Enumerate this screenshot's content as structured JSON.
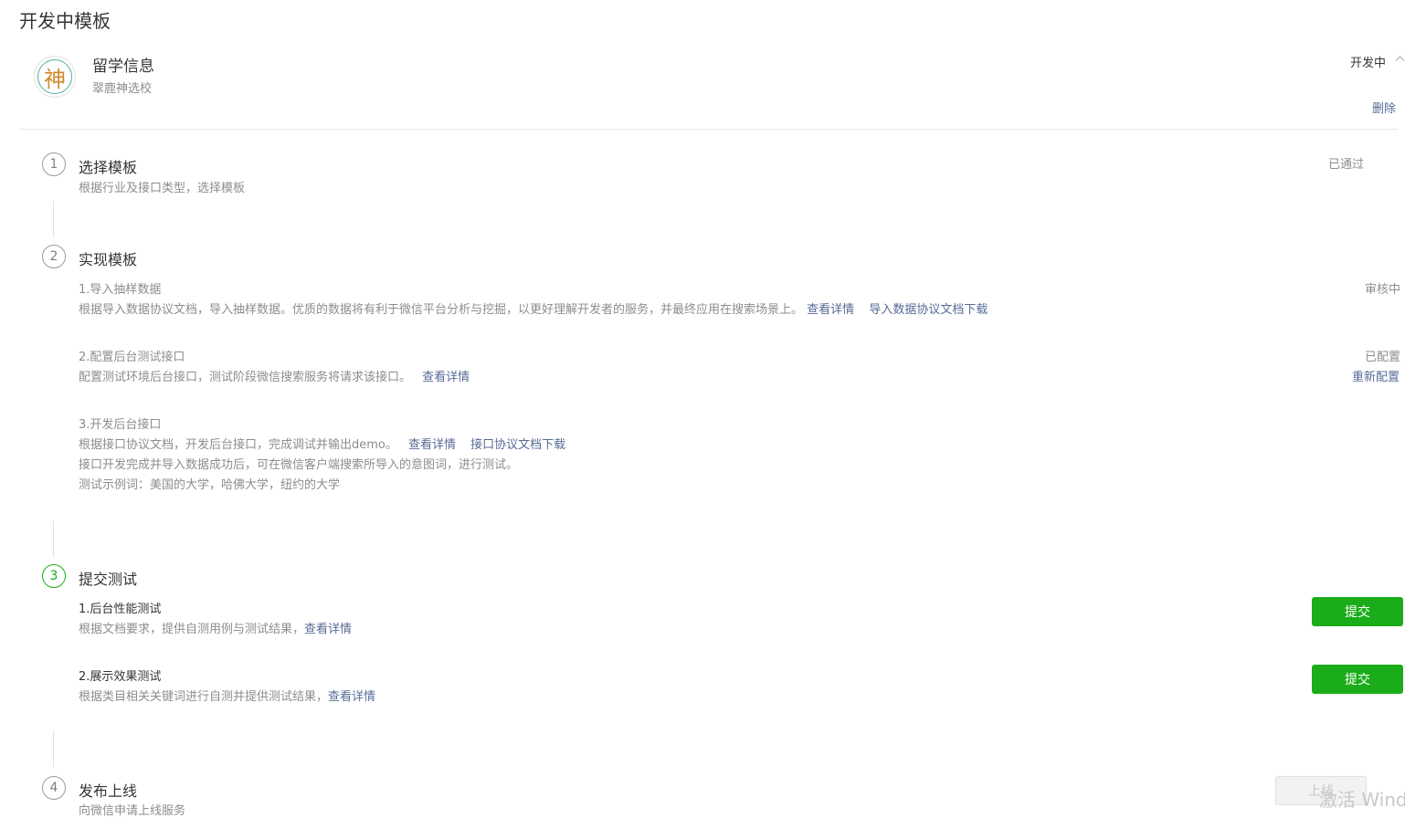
{
  "page": {
    "title": "开发中模板"
  },
  "app": {
    "logo_char": "神",
    "name": "留学信息",
    "subtitle": "翠鹿神选校",
    "state": "开发中",
    "delete_label": "删除"
  },
  "steps": [
    {
      "num": "1",
      "title": "选择模板",
      "desc": "根据行业及接口类型，选择模板",
      "status": "已通过"
    },
    {
      "num": "2",
      "title": "实现模板",
      "subs": [
        {
          "title": "1.导入抽样数据",
          "desc": "根据导入数据协议文档，导入抽样数据。优质的数据将有利于微信平台分析与挖掘，以更好理解开发者的服务，并最终应用在搜索场景上。",
          "link1": "查看详情",
          "link2": "导入数据协议文档下载",
          "status": "审核中"
        },
        {
          "title": "2.配置后台测试接口",
          "desc": "配置测试环境后台接口，测试阶段微信搜索服务将请求该接口。",
          "link1": "查看详情",
          "status": "已配置",
          "action": "重新配置"
        },
        {
          "title": "3.开发后台接口",
          "desc": "根据接口协议文档，开发后台接口，完成调试并输出demo。",
          "link1": "查看详情",
          "link2": "接口协议文档下载",
          "line2": "接口开发完成并导入数据成功后，可在微信客户端搜索所导入的意图词，进行测试。",
          "line3": "测试示例词：美国的大学，哈佛大学，纽约的大学"
        }
      ]
    },
    {
      "num": "3",
      "title": "提交测试",
      "subs": [
        {
          "title": "1.后台性能测试",
          "desc": "根据文档要求，提供自测用例与测试结果，",
          "link1": "查看详情",
          "button": "提交"
        },
        {
          "title": "2.展示效果测试",
          "desc": "根据类目相关关键词进行自测并提供测试结果，",
          "link1": "查看详情",
          "button": "提交"
        }
      ]
    },
    {
      "num": "4",
      "title": "发布上线",
      "desc": "向微信申请上线服务",
      "button": "上线"
    }
  ],
  "watermark": "激活 Wind"
}
